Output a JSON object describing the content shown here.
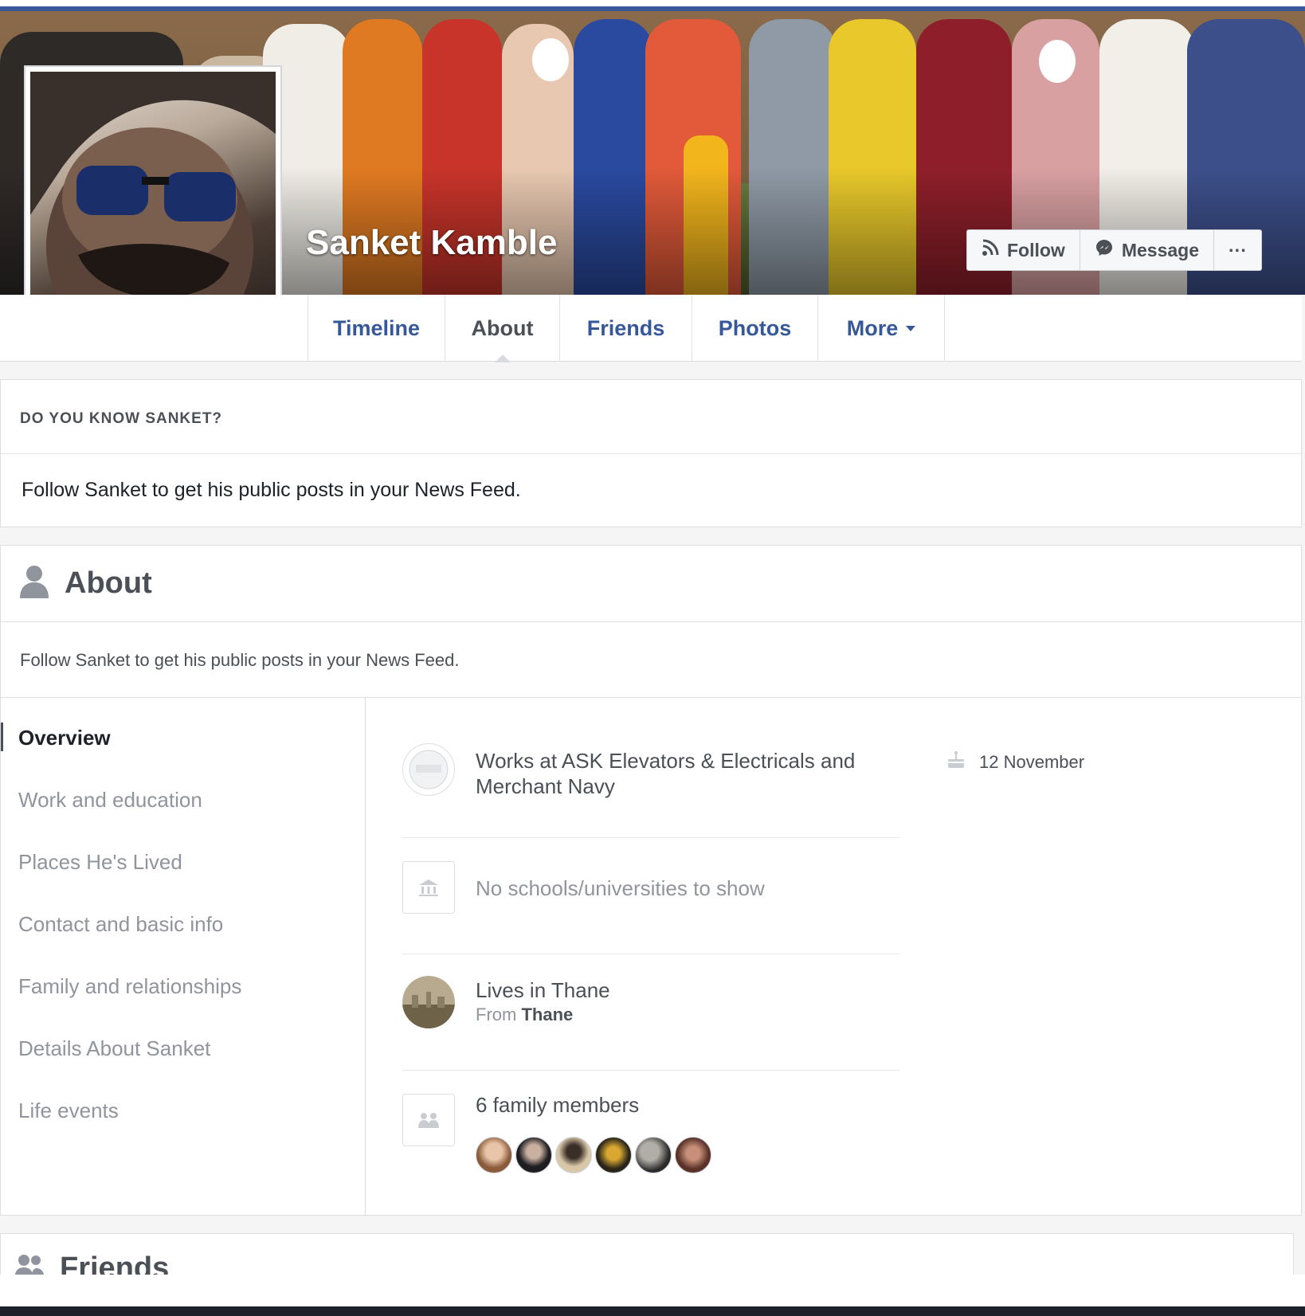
{
  "profile": {
    "name": "Sanket Kamble"
  },
  "cover_actions": {
    "follow_label": "Follow",
    "message_label": "Message",
    "more_label": "···"
  },
  "tabs": [
    {
      "label": "Timeline"
    },
    {
      "label": "About"
    },
    {
      "label": "Friends"
    },
    {
      "label": "Photos"
    },
    {
      "label": "More"
    }
  ],
  "know": {
    "title": "DO YOU KNOW SANKET?",
    "body": "Follow Sanket to get his public posts in your News Feed."
  },
  "about": {
    "title": "About",
    "subtitle": "Follow Sanket to get his public posts in your News Feed.",
    "nav": [
      {
        "label": "Overview"
      },
      {
        "label": "Work and education"
      },
      {
        "label": "Places He's Lived"
      },
      {
        "label": "Contact and basic info"
      },
      {
        "label": "Family and relationships"
      },
      {
        "label": "Details About Sanket"
      },
      {
        "label": "Life events"
      }
    ],
    "overview": {
      "work_line1": "Works at ASK Elevators & Electricals and",
      "work_line2": "Merchant Navy",
      "school": "No schools/universities to show",
      "lives": "Lives in Thane",
      "from_prefix": "From",
      "from_city": "Thane",
      "family": "6 family members",
      "birthday": "12 November"
    }
  },
  "friends": {
    "title": "Friends"
  },
  "colors": {
    "link_blue": "#365899",
    "brand_blue": "#3b5998",
    "muted_gray": "#90949c",
    "text_dark": "#4b4f56"
  }
}
